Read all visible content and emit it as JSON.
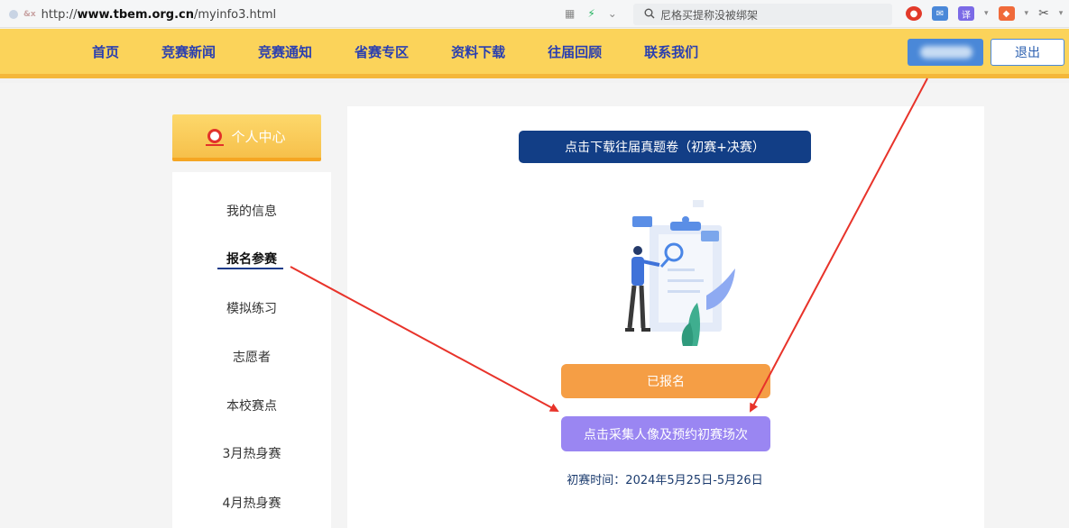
{
  "browser": {
    "url_prefix": "http://",
    "url_domain": "www.tbem.org.cn",
    "url_path": "/myinfo3.html",
    "search_text": "尼格买提称没被绑架",
    "translate_icon_label": "译"
  },
  "nav": {
    "items": [
      "首页",
      "竞赛新闻",
      "竞赛通知",
      "省赛专区",
      "资料下载",
      "往届回顾",
      "联系我们"
    ],
    "logout": "退出"
  },
  "sidebar": {
    "header": "个人中心",
    "items": [
      "我的信息",
      "报名参赛",
      "模拟练习",
      "志愿者",
      "本校赛点",
      "3月热身赛",
      "4月热身赛"
    ],
    "active_index": 1
  },
  "main": {
    "download_button": "点击下载往届真题卷（初赛+决赛）",
    "registered_button": "已报名",
    "photo_button": "点击采集人像及预约初赛场次",
    "exam_time": "初赛时间：2024年5月25日-5月26日"
  },
  "colors": {
    "nav_bg": "#fbd35a",
    "nav_text": "#2a3fb0",
    "download_btn": "#123e86",
    "registered_btn": "#f59e45",
    "photo_btn": "#9a86f2",
    "annotation_arrow": "#e8332a"
  }
}
